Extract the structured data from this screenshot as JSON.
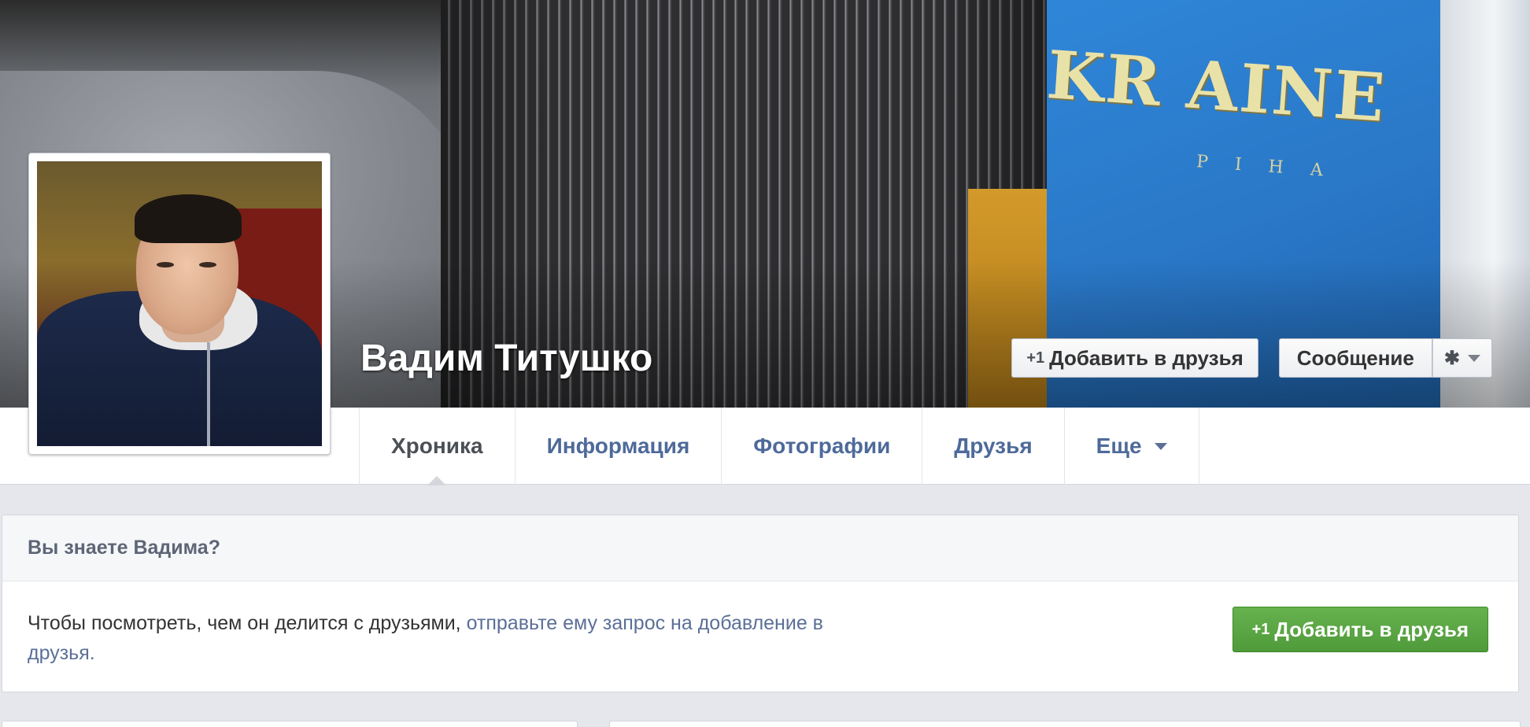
{
  "profile": {
    "name": "Вадим Титушко"
  },
  "cover_actions": {
    "add_friend_plus": "+1",
    "add_friend_label": "Добавить в друзья",
    "message_label": "Сообщение",
    "settings_glyph": "✱"
  },
  "cover_photo": {
    "shirt_text": "KR AINE",
    "shirt_subtext": "РІНА"
  },
  "tabs": [
    {
      "label": "Хроника"
    },
    {
      "label": "Информация"
    },
    {
      "label": "Фотографии"
    },
    {
      "label": "Друзья"
    },
    {
      "label": "Еще"
    }
  ],
  "know_card": {
    "title": "Вы знаете Вадима?",
    "text_plain": "Чтобы посмотреть, чем он делится с друзьями, ",
    "text_link": "отправьте ему запрос на добавление в",
    "text_tail": "друзья.",
    "button_plus": "+1",
    "button_label": "Добавить в друзья"
  },
  "colors": {
    "link": "#5b6f98",
    "green_button": "#5aa743",
    "page_bg": "#e5e7ec"
  }
}
